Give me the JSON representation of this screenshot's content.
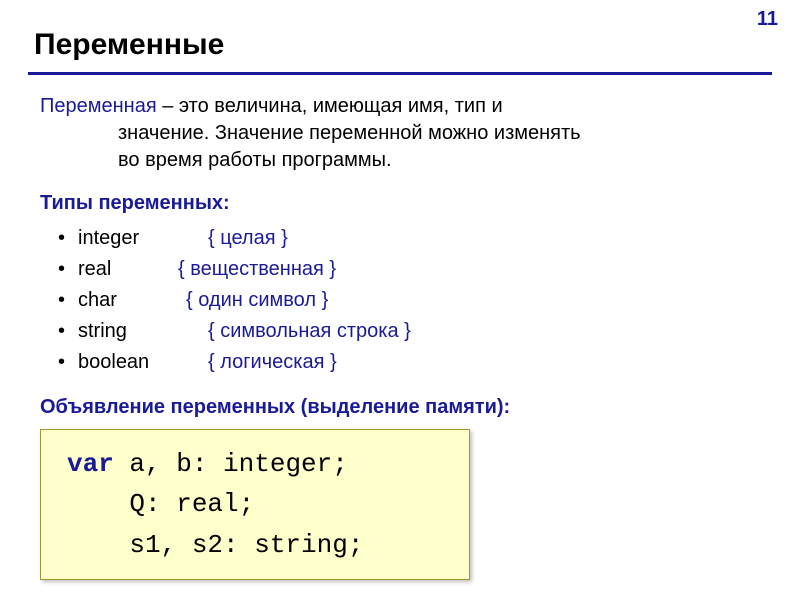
{
  "page_number": "11",
  "title": "Переменные",
  "definition": {
    "term": "Переменная",
    "rest_line1": " – это величина, имеющая имя, тип и",
    "line2": "значение. Значение переменной можно изменять",
    "line3": "во время работы программы."
  },
  "types_heading": "Типы переменных:",
  "types": [
    {
      "name": "integer",
      "comment": "{ целая }"
    },
    {
      "name": "real",
      "comment": "{ вещественная }"
    },
    {
      "name": "char",
      "comment": "{ один символ }"
    },
    {
      "name": "string",
      "comment": "{ символьная строка }"
    },
    {
      "name": "boolean",
      "comment": "{ логическая }"
    }
  ],
  "decl_heading": "Объявление переменных (выделение памяти):",
  "code": {
    "kw_var": "var",
    "line1_rest": " a, b: integer;",
    "line2": "    Q: real;",
    "line3": "    s1, s2: string;"
  }
}
